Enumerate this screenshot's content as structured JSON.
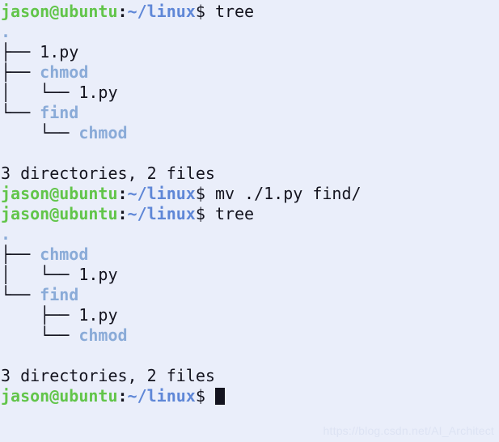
{
  "terminal": {
    "prompt": {
      "user_host": "jason@ubuntu",
      "separator": ":",
      "path": "~/linux",
      "symbol": "$ "
    },
    "colors": {
      "background": "#eaeefa",
      "foreground": "#14141f",
      "prompt_user": "#62c54a",
      "prompt_path": "#5f87d7",
      "directory": "#8aabd8",
      "cursor": "#14141f",
      "watermark": "#dde3f3"
    },
    "lines": [
      {
        "type": "prompt",
        "command": "tree"
      },
      {
        "type": "tree-root",
        "branch": "",
        "name": ".",
        "kind": "dot"
      },
      {
        "type": "tree",
        "branch": "├── ",
        "name": "1.py",
        "kind": "file"
      },
      {
        "type": "tree",
        "branch": "├── ",
        "name": "chmod",
        "kind": "dir"
      },
      {
        "type": "tree",
        "branch": "│   └── ",
        "name": "1.py",
        "kind": "file"
      },
      {
        "type": "tree",
        "branch": "└── ",
        "name": "find",
        "kind": "dir"
      },
      {
        "type": "tree",
        "branch": "    └── ",
        "name": "chmod",
        "kind": "dir"
      },
      {
        "type": "blank",
        "text": " "
      },
      {
        "type": "output",
        "text": "3 directories, 2 files"
      },
      {
        "type": "prompt",
        "command": "mv ./1.py find/"
      },
      {
        "type": "prompt",
        "command": "tree"
      },
      {
        "type": "tree-root",
        "branch": "",
        "name": ".",
        "kind": "dot"
      },
      {
        "type": "tree",
        "branch": "├── ",
        "name": "chmod",
        "kind": "dir"
      },
      {
        "type": "tree",
        "branch": "│   └── ",
        "name": "1.py",
        "kind": "file"
      },
      {
        "type": "tree",
        "branch": "└── ",
        "name": "find",
        "kind": "dir"
      },
      {
        "type": "tree",
        "branch": "    ├── ",
        "name": "1.py",
        "kind": "file"
      },
      {
        "type": "tree",
        "branch": "    └── ",
        "name": "chmod",
        "kind": "dir"
      },
      {
        "type": "blank",
        "text": " "
      },
      {
        "type": "output",
        "text": "3 directories, 2 files"
      },
      {
        "type": "prompt-cursor",
        "command": ""
      }
    ]
  },
  "watermark": {
    "text": "https://blog.csdn.net/AI_Architect"
  }
}
